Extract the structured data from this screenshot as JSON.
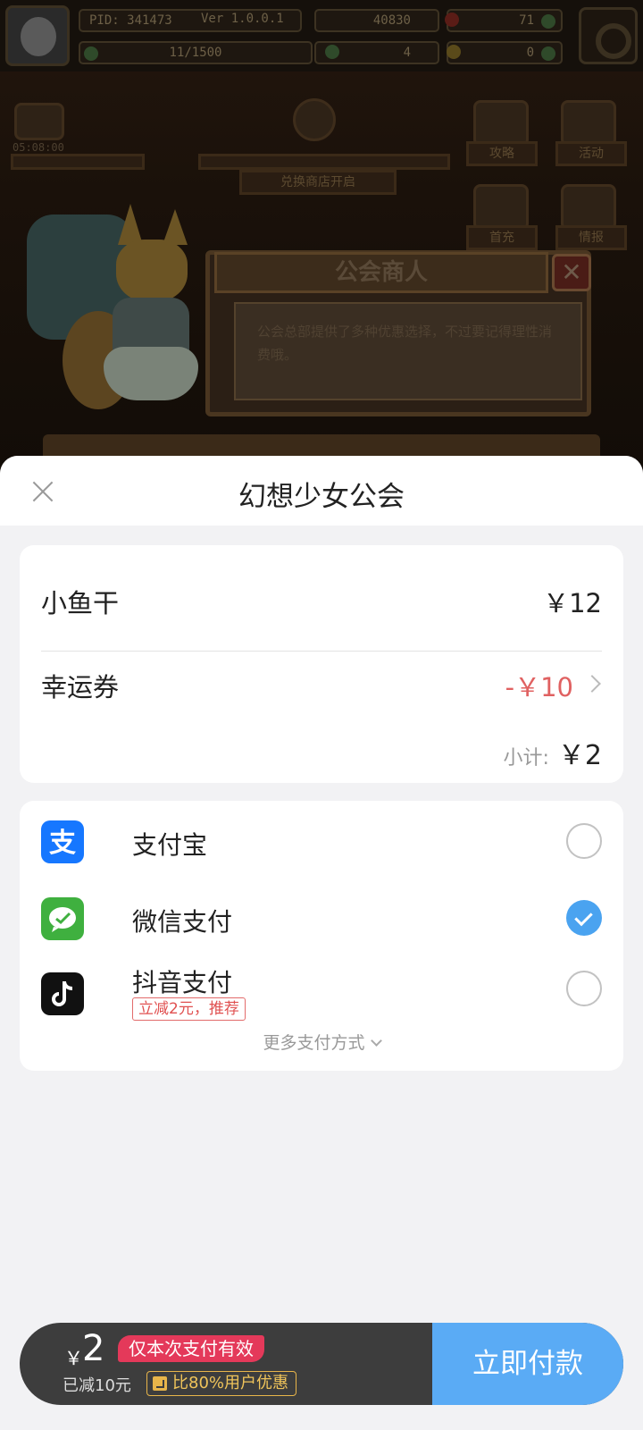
{
  "game": {
    "pid": "PID: 341473",
    "version": "Ver 1.0.0.1",
    "exp": "11/1500",
    "coins": "40830",
    "gems": "71",
    "clover": "4",
    "keys": "0",
    "timer": "05:08:00",
    "shop_banner": "兑换商店开启",
    "buttons": [
      "攻略",
      "活动",
      "首充",
      "情报"
    ],
    "dialog_title": "公会商人",
    "dialog_text": "公会总部提供了多种优惠选择，不过要记得理性消费哦。",
    "dialog_close": "✕"
  },
  "sheet": {
    "title": "幻想少女公会",
    "order": {
      "product_name": "小鱼干",
      "product_price": "￥12",
      "coupon_label": "幸运券",
      "coupon_value": "-￥10",
      "subtotal_label": "小计:",
      "subtotal_value": "￥2"
    },
    "payment_methods": [
      {
        "label": "支付宝",
        "icon": "alipay-icon",
        "color": "#1677ff",
        "selected": false
      },
      {
        "label": "微信支付",
        "icon": "wechat-pay-icon",
        "color": "#3fb03f",
        "selected": true
      },
      {
        "label": "抖音支付",
        "icon": "douyin-pay-icon",
        "color": "#111111",
        "selected": false,
        "promo": "立减2元，推荐"
      }
    ],
    "more_methods": "更多支付方式"
  },
  "pay_bar": {
    "currency": "￥",
    "amount": "2",
    "valid_tag": "仅本次支付有效",
    "saved": "已减10元",
    "compare": "比80%用户优惠",
    "button": "立即付款"
  },
  "colors": {
    "accent_blue": "#5aabf5",
    "discount_red": "#e06161",
    "tag_pink": "#e4395a",
    "tag_gold": "#e8b54a"
  }
}
